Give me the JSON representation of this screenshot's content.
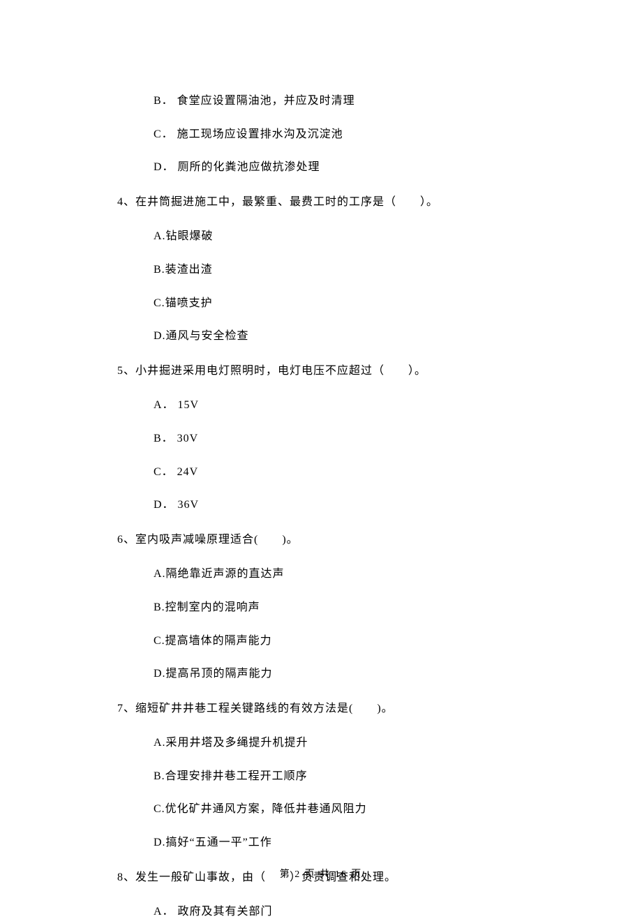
{
  "q3": {
    "optB": "B． 食堂应设置隔油池，并应及时清理",
    "optC": "C． 施工现场应设置排水沟及沉淀池",
    "optD": "D． 厕所的化粪池应做抗渗处理"
  },
  "q4": {
    "stem": "4、在井筒掘进施工中，最繁重、最费工时的工序是（　　）。",
    "optA": "A.钻眼爆破",
    "optB": "B.装渣出渣",
    "optC": "C.锚喷支护",
    "optD": "D.通风与安全检查"
  },
  "q5": {
    "stem": "5、小井掘进采用电灯照明时，电灯电压不应超过（　　）。",
    "optA": "A． 15V",
    "optB": "B． 30V",
    "optC": "C． 24V",
    "optD": "D． 36V"
  },
  "q6": {
    "stem": "6、室内吸声减噪原理适合(　　)。",
    "optA": "A.隔绝靠近声源的直达声",
    "optB": "B.控制室内的混响声",
    "optC": "C.提高墙体的隔声能力",
    "optD": "D.提高吊顶的隔声能力"
  },
  "q7": {
    "stem": "7、缩短矿井井巷工程关键路线的有效方法是(　　)。",
    "optA": "A.采用井塔及多绳提升机提升",
    "optB": "B.合理安排井巷工程开工顺序",
    "optC": "C.优化矿井通风方案，降低井巷通风阻力",
    "optD": "D.搞好“五通一平”工作"
  },
  "q8": {
    "stem": "8、发生一般矿山事故，由（　　）负责调查和处理。",
    "optA": "A． 政府及其有关部门"
  },
  "footer": "第 2 页 共 16 页"
}
